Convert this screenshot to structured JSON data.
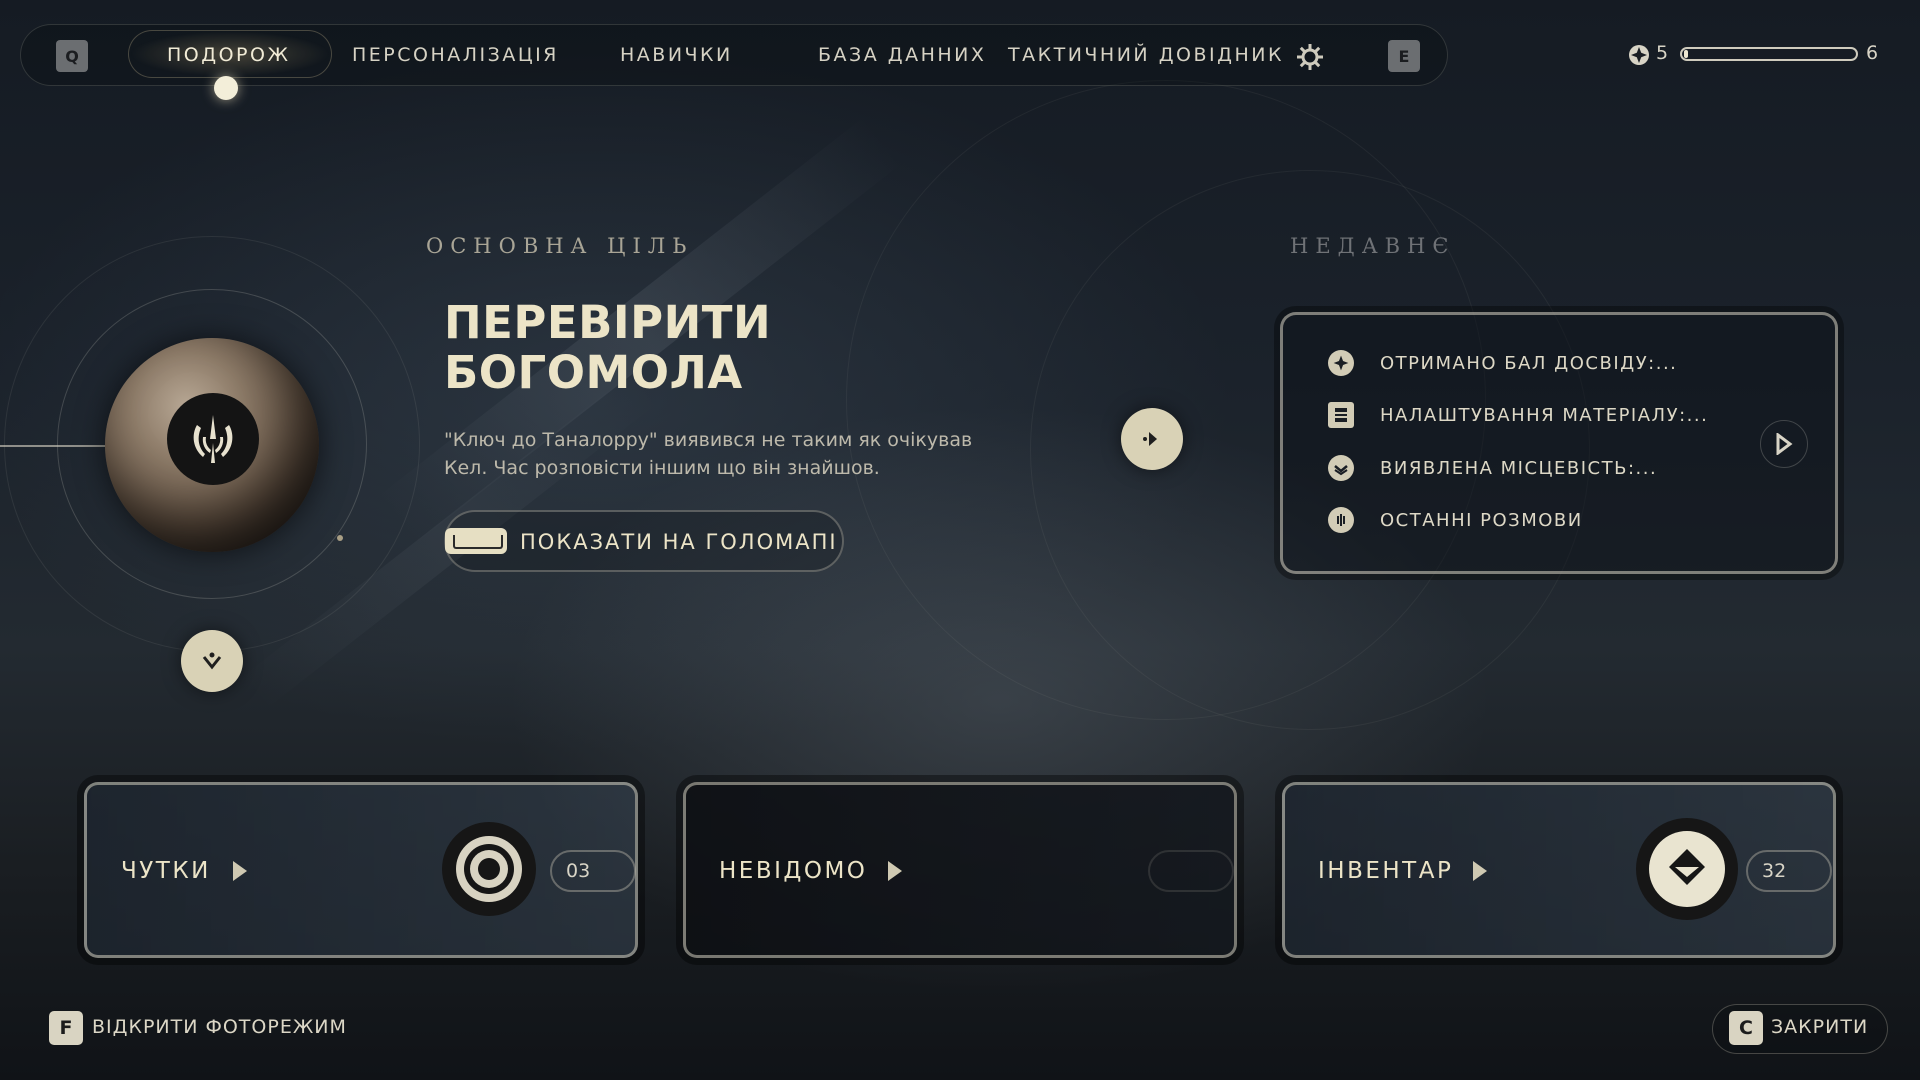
{
  "nav": {
    "left_key": "Q",
    "right_key": "E",
    "tabs": [
      {
        "label": "ПОДОРОЖ",
        "active": true
      },
      {
        "label": "ПЕРСОНАЛІЗАЦІЯ",
        "active": false
      },
      {
        "label": "НАВИЧКИ",
        "active": false
      },
      {
        "label": "БАЗА ДАННИХ",
        "active": false
      },
      {
        "label": "ТАКТИЧНИЙ ДОВІДНИК",
        "active": false
      }
    ],
    "settings_icon": "gear-icon"
  },
  "xp": {
    "current_level": "5",
    "next_level": "6",
    "progress": 0.02,
    "icon": "skill-point-icon"
  },
  "objective": {
    "section_label": "ОСНОВНА ЦІЛЬ",
    "title": "ПЕРЕВІРИТИ БОГОМОЛА",
    "description": "\"Ключ до Таналорру\" виявився не таким як очікував Кел. Час розповісти іншим що він знайшов.",
    "holomap_button": "ПОКАЗАТИ НА ГОЛОМАПІ",
    "planet_emblem": "jedi-order-icon"
  },
  "recent": {
    "section_label": "НЕДАВНЄ",
    "items": [
      {
        "icon": "skill-point-icon",
        "label": "ОТРИМАНО БАЛ ДОСВІДУ:..."
      },
      {
        "icon": "material-icon",
        "label": "НАЛАШТУВАННЯ МАТЕРІАЛУ:..."
      },
      {
        "icon": "location-icon",
        "label": "ВИЯВЛЕНА МІСЦЕВІСТЬ:..."
      },
      {
        "icon": "conversation-icon",
        "label": "ОСТАННІ РОЗМОВИ"
      }
    ]
  },
  "cards": [
    {
      "label": "ЧУТКИ",
      "count": "03",
      "icon": "rumors-icon"
    },
    {
      "label": "НЕВІДОМО",
      "count": "",
      "icon": ""
    },
    {
      "label": "ІНВЕНТАР",
      "count": "32",
      "icon": "inventory-icon"
    }
  ],
  "footer": {
    "photo_key": "F",
    "photo_label": "ВІДКРИТИ ФОТОРЕЖИМ",
    "close_key": "C",
    "close_label": "ЗАКРИТИ"
  },
  "colors": {
    "accent": "#ece4c7",
    "button_fill": "#d9d2b6",
    "background": "#1b222b"
  }
}
